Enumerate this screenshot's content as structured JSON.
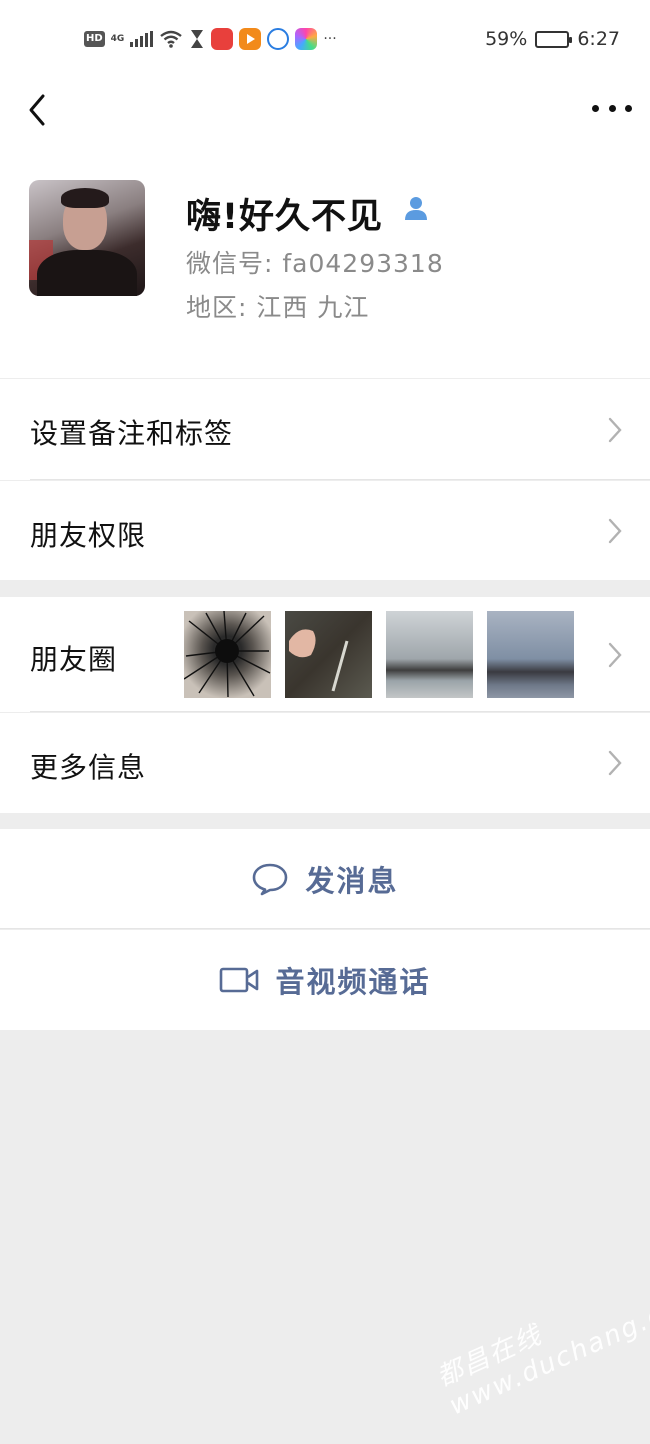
{
  "status_bar": {
    "hd_badge": "HD",
    "network": "4G",
    "battery_percent": "59%",
    "battery_level": 0.59,
    "time": "6:27",
    "overflow": "···"
  },
  "nav": {
    "back_icon": "chevron-left-icon",
    "more_icon": "more-dots-icon"
  },
  "profile": {
    "nickname": "嗨!好久不见",
    "wechat_id": "微信号: fa04293318",
    "region": "地区: 江西  九江",
    "gender_icon": "male-user-icon",
    "gender_color": "#5b9be0"
  },
  "rows": {
    "remark_tags": "设置备注和标签",
    "friend_permissions": "朋友权限",
    "moments": "朋友圈",
    "more_info": "更多信息"
  },
  "actions": {
    "send_message": "发消息",
    "video_call": "音视频通话",
    "link_color": "#576b95"
  },
  "watermark": "都昌在线 www.duchang.org"
}
